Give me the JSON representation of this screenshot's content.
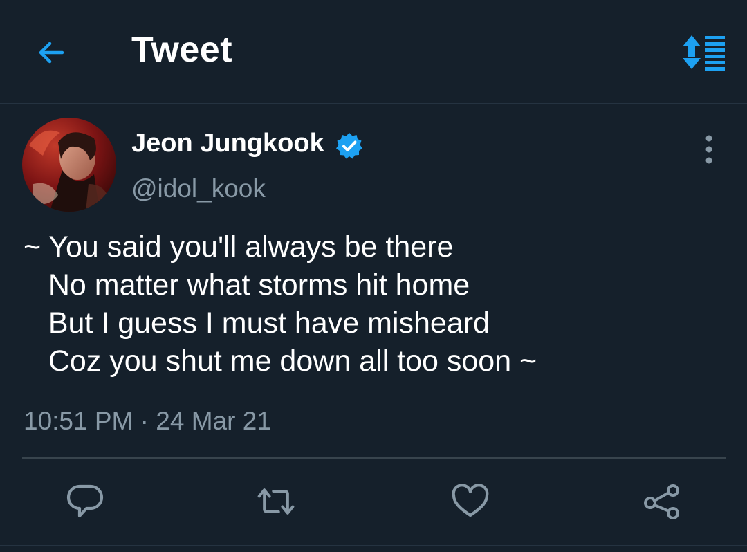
{
  "header": {
    "title": "Tweet",
    "back_icon": "back-arrow-icon",
    "sort_icon": "sort-timeline-icon",
    "accent_color": "#1da1f2"
  },
  "author": {
    "name": "Jeon Jungkook",
    "handle": "@idol_kook",
    "verified": true,
    "verified_icon": "verified-badge-icon"
  },
  "tweet": {
    "text": "~ You said you'll always be there\n   No matter what storms hit home\n   But I guess I must have misheard\n   Coz you shut me down all too soon ~",
    "time": "10:51 PM",
    "separator": "·",
    "date": "24 Mar 21"
  },
  "actions": [
    {
      "name": "reply",
      "icon": "reply-icon"
    },
    {
      "name": "retweet",
      "icon": "retweet-icon"
    },
    {
      "name": "like",
      "icon": "heart-icon"
    },
    {
      "name": "share",
      "icon": "share-icon"
    }
  ],
  "colors": {
    "background": "#15202b",
    "secondary_text": "#8899a6",
    "divider": "#38444d",
    "icon_gray": "#8899a6",
    "accent": "#1da1f2"
  }
}
